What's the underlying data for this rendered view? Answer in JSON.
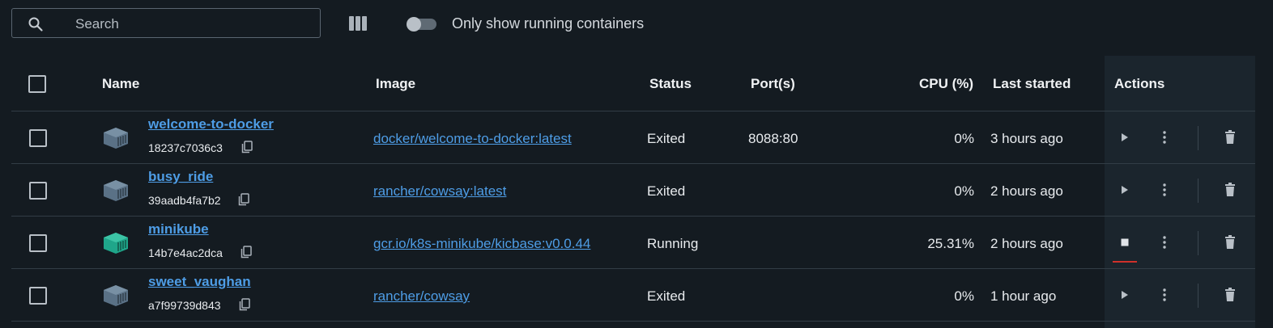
{
  "search": {
    "placeholder": "Search"
  },
  "toolbar": {
    "columns_icon": "columns-icon",
    "toggle_label": "Only show running containers",
    "toggle_on": false
  },
  "table": {
    "headers": {
      "name": "Name",
      "image": "Image",
      "status": "Status",
      "ports": "Port(s)",
      "cpu": "CPU (%)",
      "last_started": "Last started",
      "actions": "Actions"
    },
    "rows": [
      {
        "name": "welcome-to-docker",
        "id": "18237c7036c3",
        "image": "docker/welcome-to-docker:latest",
        "status": "Exited",
        "ports": "8088:80",
        "cpu": "0%",
        "last_started": "3 hours ago",
        "running": false
      },
      {
        "name": "busy_ride",
        "id": "39aadb4fa7b2",
        "image": "rancher/cowsay:latest",
        "status": "Exited",
        "ports": "",
        "cpu": "0%",
        "last_started": "2 hours ago",
        "running": false
      },
      {
        "name": "minikube",
        "id": "14b7e4ac2dca",
        "image": "gcr.io/k8s-minikube/kicbase:v0.0.44",
        "status": "Running",
        "ports": "",
        "cpu": "25.31%",
        "last_started": "2 hours ago",
        "running": true
      },
      {
        "name": "sweet_vaughan",
        "id": "a7f99739d843",
        "image": "rancher/cowsay",
        "status": "Exited",
        "ports": "",
        "cpu": "0%",
        "last_started": "1 hour ago",
        "running": false
      }
    ]
  },
  "colors": {
    "background": "#141b21",
    "link": "#4e9de6",
    "running_container": "#1fa68a",
    "stopped_container": "#5a7186",
    "stop_underline": "#d0302a"
  },
  "icons": {
    "search": "search-icon",
    "container": "container-icon",
    "copy": "copy-icon",
    "start": "play-icon",
    "stop": "stop-icon",
    "more": "more-vertical-icon",
    "delete": "trash-icon"
  }
}
